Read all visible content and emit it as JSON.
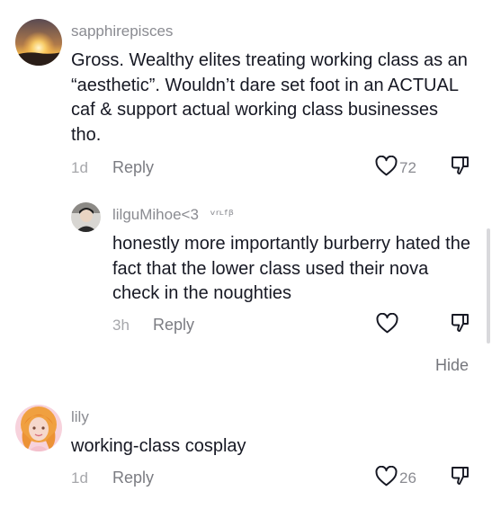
{
  "comments": [
    {
      "username": "sapphirepisces",
      "text": "Gross. Wealthy elites treating working class as an “aesthetic”. Wouldn’t dare set foot in an ACTUAL caf & support actual working class businesses tho.",
      "time": "1d",
      "reply_label": "Reply",
      "likes": "72"
    },
    {
      "username": "lilguMihoe<3",
      "username_decoration": "ᵛʳᶫᶠᵝ",
      "text": "honestly more importantly burberry hated the fact that the lower class used their nova check in the noughties",
      "time": "3h",
      "reply_label": "Reply",
      "likes": ""
    },
    {
      "username": "lily",
      "text": "working-class cosplay",
      "time": "1d",
      "reply_label": "Reply",
      "likes": "26"
    }
  ],
  "hide_label": "Hide",
  "icons": {
    "like": "heart-outline-icon",
    "dislike": "thumbs-down-outline-icon"
  },
  "colors": {
    "text": "#161823",
    "secondary": "#8a8b91",
    "background": "#ffffff"
  }
}
